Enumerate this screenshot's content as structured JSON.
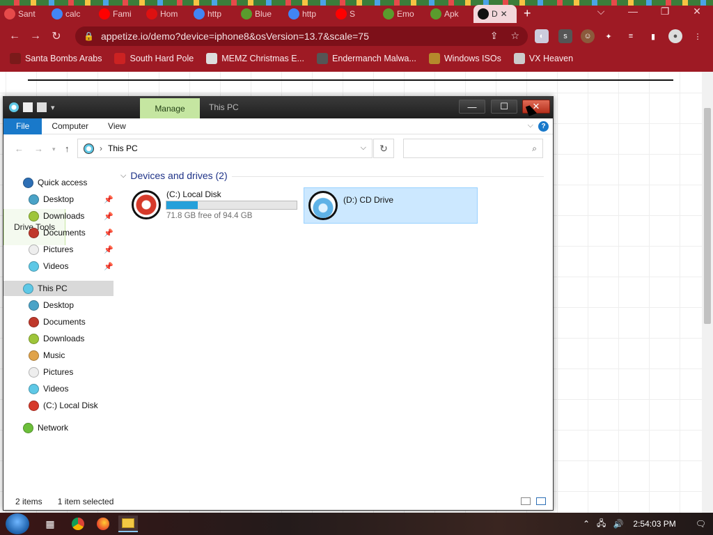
{
  "browser": {
    "tabs": [
      {
        "label": "Sant",
        "color": "#e64a4a"
      },
      {
        "label": "calc",
        "color": "#4285f4"
      },
      {
        "label": "Fami",
        "color": "#ff0000"
      },
      {
        "label": "Hom",
        "color": "#d11"
      },
      {
        "label": "http",
        "color": "#4285f4"
      },
      {
        "label": "Blue",
        "color": "#5a9b2d"
      },
      {
        "label": "http",
        "color": "#4285f4"
      },
      {
        "label": "S",
        "color": "#ff0000"
      },
      {
        "label": "Emo",
        "color": "#5a9b2d"
      },
      {
        "label": "Apk",
        "color": "#5a9b2d"
      },
      {
        "label": "D",
        "color": "#111"
      }
    ],
    "new_tab": "+",
    "url": "appetize.io/demo?device=iphone8&osVersion=13.7&scale=75",
    "window_controls": {
      "chevron": "⌵",
      "min": "—",
      "max": "❐",
      "close": "✕"
    },
    "bookmarks": [
      {
        "label": "Santa Bombs Arabs",
        "color": "#7a1a1a"
      },
      {
        "label": "South Hard Pole",
        "color": "#c22"
      },
      {
        "label": "MEMZ Christmas E...",
        "color": "#ddd"
      },
      {
        "label": "Endermanch Malwa...",
        "color": "#555"
      },
      {
        "label": "Windows ISOs",
        "color": "#b58a2c"
      },
      {
        "label": "VX Heaven",
        "color": "#ccc"
      }
    ]
  },
  "explorer": {
    "manage_tab": "Manage",
    "title": "This PC",
    "ribbon_tabs": [
      "File",
      "Computer",
      "View",
      "Drive Tools"
    ],
    "help_label": "?",
    "address": "This PC",
    "nav": [
      {
        "label": "Quick access",
        "indent": 0,
        "color": "#2d6fb5",
        "pin": false
      },
      {
        "label": "Desktop",
        "indent": 1,
        "color": "#4aa3c7",
        "pin": true
      },
      {
        "label": "Downloads",
        "indent": 1,
        "color": "#9ec53a",
        "pin": true
      },
      {
        "label": "Documents",
        "indent": 1,
        "color": "#c0392b",
        "pin": true
      },
      {
        "label": "Pictures",
        "indent": 1,
        "color": "#eeeeee",
        "pin": true
      },
      {
        "label": "Videos",
        "indent": 1,
        "color": "#5ec8e6",
        "pin": true
      },
      {
        "label": "This PC",
        "indent": 0,
        "color": "#5ec8e6",
        "pin": false
      },
      {
        "label": "Desktop",
        "indent": 1,
        "color": "#4aa3c7",
        "pin": false
      },
      {
        "label": "Documents",
        "indent": 1,
        "color": "#c0392b",
        "pin": false
      },
      {
        "label": "Downloads",
        "indent": 1,
        "color": "#9ec53a",
        "pin": false
      },
      {
        "label": "Music",
        "indent": 1,
        "color": "#e0a34a",
        "pin": false
      },
      {
        "label": "Pictures",
        "indent": 1,
        "color": "#eeeeee",
        "pin": false
      },
      {
        "label": "Videos",
        "indent": 1,
        "color": "#5ec8e6",
        "pin": false
      },
      {
        "label": "(C:) Local Disk",
        "indent": 1,
        "color": "#d63a2a",
        "pin": false
      },
      {
        "label": "Network",
        "indent": 0,
        "color": "#6cbf3a",
        "pin": false
      }
    ],
    "group_header": "Devices and drives (2)",
    "drives": [
      {
        "name": "(C:) Local Disk",
        "free_text": "71.8 GB free of 94.4 GB",
        "used_fraction": 0.24,
        "selected": false
      },
      {
        "name": "(D:) CD Drive",
        "free_text": "",
        "selected": true
      }
    ],
    "status": {
      "items": "2 items",
      "selected": "1 item selected"
    }
  },
  "taskbar": {
    "time": "2:54:03 PM"
  }
}
